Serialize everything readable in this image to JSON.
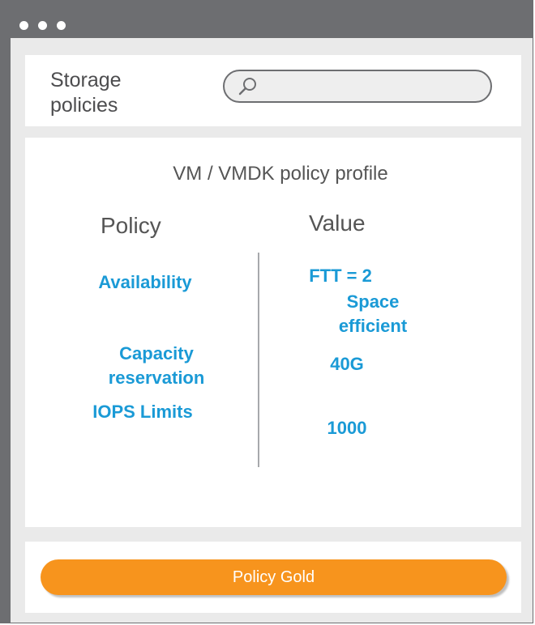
{
  "window": {
    "controls": [
      "dot",
      "dot",
      "dot"
    ]
  },
  "header": {
    "title": "Storage policies",
    "search": {
      "placeholder": "",
      "icon": "search-icon"
    }
  },
  "content": {
    "title": "VM / VMDK policy profile",
    "columns": {
      "policy": "Policy",
      "value": "Value"
    },
    "rows": [
      {
        "policy": "Availability",
        "values": [
          "FTT = 2",
          "Space efficient"
        ]
      },
      {
        "policy": "Capacity reservation",
        "values": [
          "40G"
        ]
      },
      {
        "policy": "IOPS Limits",
        "values": [
          "1000"
        ]
      }
    ]
  },
  "footer": {
    "button_label": "Policy Gold"
  },
  "colors": {
    "chrome": "#6d6e71",
    "accent_text": "#1a9ad6",
    "button": "#f7941d",
    "background": "#eaeaea"
  }
}
